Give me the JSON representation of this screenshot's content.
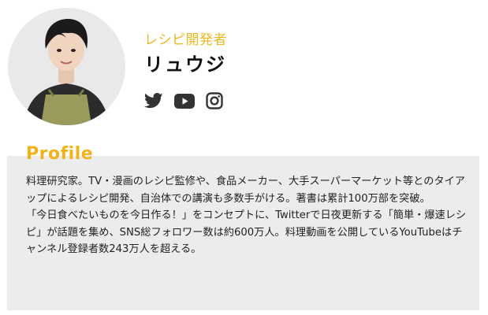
{
  "profile": {
    "role": "レシピ開発者",
    "name": "リュウジ",
    "social": [
      {
        "name": "twitter"
      },
      {
        "name": "youtube"
      },
      {
        "name": "instagram"
      }
    ],
    "heading": "Profile",
    "bio": [
      "料理研究家。TV・漫画のレシピ監修や、食品メーカー、大手スーパーマーケット等とのタイアップによるレシピ開発、自治体での講演も多数手がける。著書は累計100万部を突破。",
      "「今日食べたいものを今日作る！」をコンセプトに、Twitterで日夜更新する「簡単・爆速レシピ」が話題を集め、SNS総フォロワー数は約600万人。料理動画を公開しているYouTubeはチャンネル登録者数243万人を超える。"
    ]
  },
  "colors": {
    "accent": "#F0B31B",
    "icon": "#333333",
    "panel": "#ECECEC"
  }
}
